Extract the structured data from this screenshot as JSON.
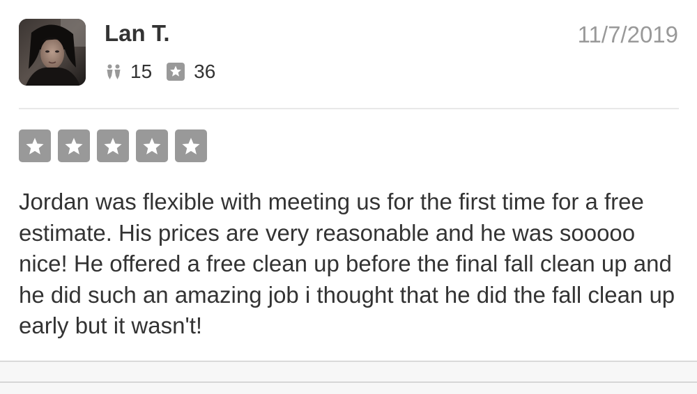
{
  "review": {
    "user": {
      "name": "Lan T.",
      "avatar_icon": "user-photo",
      "friends_icon": "friends-icon",
      "friends_count": "15",
      "reviews_icon": "star-icon",
      "reviews_count": "36"
    },
    "date": "11/7/2019",
    "rating": {
      "stars": 5,
      "max_stars": 5,
      "star_color": "#999999"
    },
    "text": "Jordan was flexible with meeting us for the first time for a free estimate. His prices are very reasonable and he was sooooo nice! He offered a free clean up before the final fall clean up and he did such an amazing job i thought that he did the fall clean up early but it wasn't!"
  },
  "colors": {
    "text": "#333333",
    "muted": "#999999",
    "divider": "#e8e8e8"
  }
}
